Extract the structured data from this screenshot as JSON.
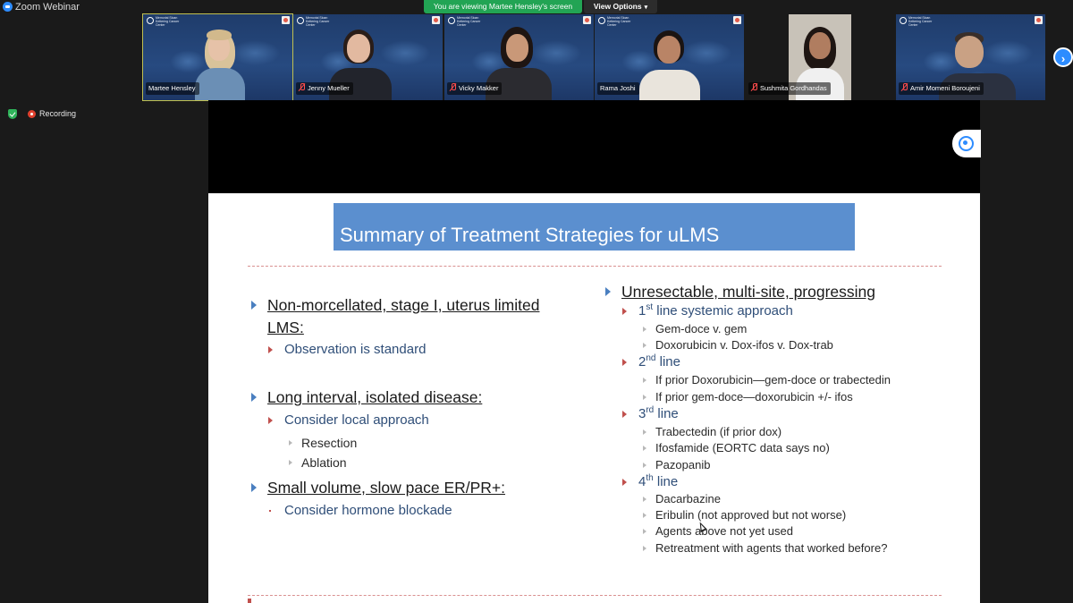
{
  "window": {
    "app_title": "Zoom Webinar",
    "share_banner": "You are viewing Martee Hensley's screen",
    "view_options": "View Options",
    "view_options_icon": "chevron-down-icon"
  },
  "gallery": {
    "tile_logo_text": "Memorial Sloan Kettering Cancer Center",
    "tiles": [
      {
        "name": "Martee Hensley",
        "muted": false,
        "active": true
      },
      {
        "name": "Jenny Mueller",
        "muted": true,
        "active": false
      },
      {
        "name": "Vicky Makker",
        "muted": true,
        "active": false
      },
      {
        "name": "Rama Joshi",
        "muted": false,
        "active": false
      },
      {
        "name": "Sushmita Gordhandas",
        "muted": true,
        "active": false
      },
      {
        "name": "Amir Momeni Boroujeni",
        "muted": true,
        "active": false
      }
    ],
    "next_icon": "chevron-right-icon"
  },
  "status": {
    "security_icon": "shield-check-icon",
    "recording_label": "Recording"
  },
  "slide": {
    "title": "Summary of Treatment Strategies for uLMS",
    "left": {
      "b1_l1": "Non-morcellated, stage I, uterus limited",
      "b1_l2": "LMS:",
      "b1_sub": "Observation is standard",
      "b2": "Long interval, isolated disease",
      "b2_tail": ":",
      "b2_sub": "Consider local approach",
      "b2_items": [
        "Resection",
        "Ablation"
      ],
      "b3": "Small volume, slow pace ER/PR+:",
      "b3_sub": "Consider hormone blockade"
    },
    "right": {
      "head": "Unresectable, multi-site, progressing",
      "l1_num": "1",
      "l1_sup": "st",
      "l1_text": " line systemic approach",
      "l1_items": [
        "Gem-doce v. gem",
        "Doxorubicin v. Dox-ifos v. Dox-trab"
      ],
      "l2_num": "2",
      "l2_sup": "nd",
      "l2_text": " line",
      "l2_items": [
        "If prior Doxorubicin—gem-doce or trabectedin",
        "If prior gem-doce—doxorubicin +/- ifos"
      ],
      "l3_num": "3",
      "l3_sup": "rd",
      "l3_text": " line",
      "l3_items": [
        "Trabectedin (if prior dox)",
        "Ifosfamide (EORTC data says no)",
        "Pazopanib"
      ],
      "l4_num": "4",
      "l4_sup": "th",
      "l4_text": " line",
      "l4_items": [
        "Dacarbazine",
        "Eribulin (not approved but not worse)",
        "Agents above not yet used",
        "Retreatment  with agents that worked before?"
      ]
    }
  }
}
